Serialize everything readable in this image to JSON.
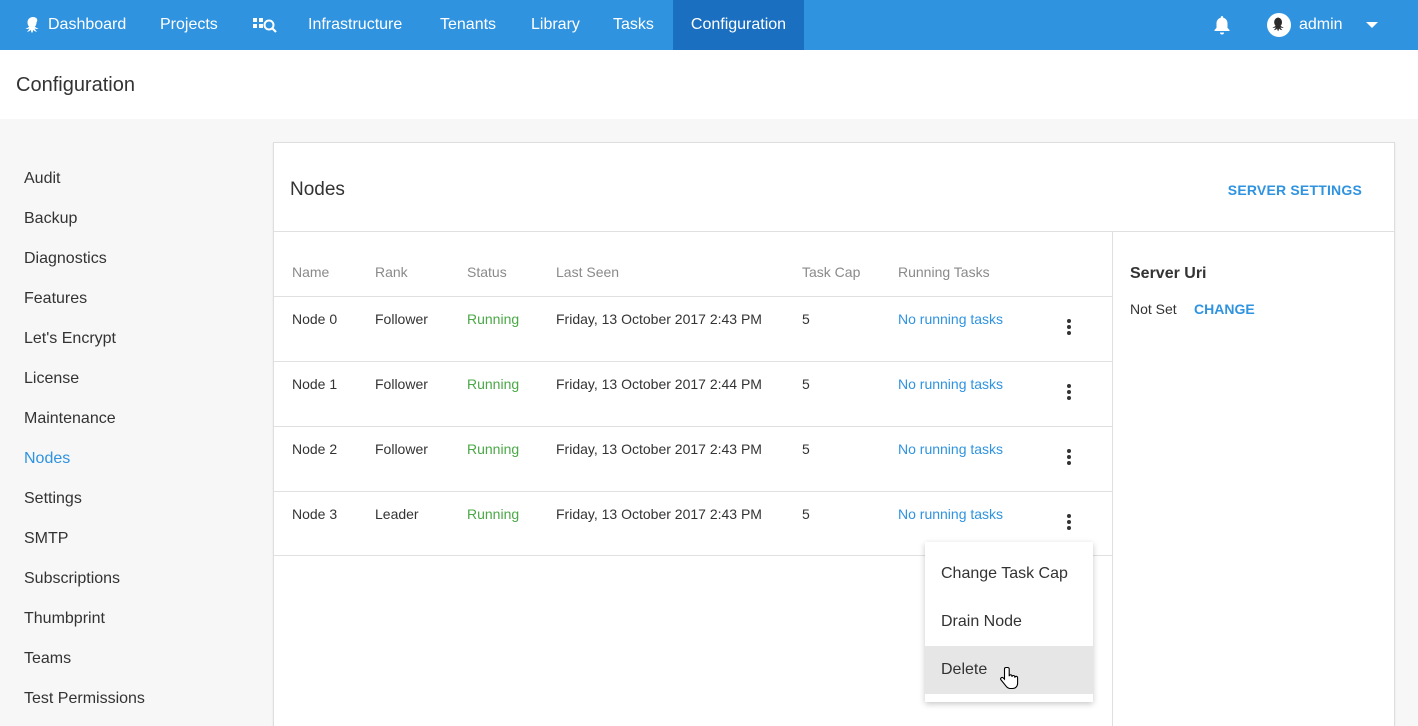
{
  "nav": {
    "dashboard": "Dashboard",
    "projects": "Projects",
    "infrastructure": "Infrastructure",
    "tenants": "Tenants",
    "library": "Library",
    "tasks": "Tasks",
    "configuration": "Configuration",
    "user": "admin",
    "icons": {
      "logo": "octopus-icon",
      "search": "search-icon",
      "bell": "bell-icon",
      "avatar": "avatar-icon"
    }
  },
  "colors": {
    "primary": "#2f93e0",
    "active_nav": "#1a6fc0",
    "running": "#4aa846"
  },
  "page": {
    "title": "Configuration"
  },
  "sidebar": {
    "items": [
      "Audit",
      "Backup",
      "Diagnostics",
      "Features",
      "Let's Encrypt",
      "License",
      "Maintenance",
      "Nodes",
      "Settings",
      "SMTP",
      "Subscriptions",
      "Thumbprint",
      "Teams",
      "Test Permissions"
    ],
    "active": "Nodes"
  },
  "card": {
    "title": "Nodes",
    "action": "SERVER SETTINGS"
  },
  "table": {
    "columns": [
      "Name",
      "Rank",
      "Status",
      "Last Seen",
      "Task Cap",
      "Running Tasks"
    ],
    "rows": [
      {
        "name": "Node 0",
        "rank": "Follower",
        "status": "Running",
        "last_seen": "Friday, 13 October 2017 2:43 PM",
        "task_cap": "5",
        "running_tasks": "No running tasks"
      },
      {
        "name": "Node 1",
        "rank": "Follower",
        "status": "Running",
        "last_seen": "Friday, 13 October 2017 2:44 PM",
        "task_cap": "5",
        "running_tasks": "No running tasks"
      },
      {
        "name": "Node 2",
        "rank": "Follower",
        "status": "Running",
        "last_seen": "Friday, 13 October 2017 2:43 PM",
        "task_cap": "5",
        "running_tasks": "No running tasks"
      },
      {
        "name": "Node 3",
        "rank": "Leader",
        "status": "Running",
        "last_seen": "Friday, 13 October 2017 2:43 PM",
        "task_cap": "5",
        "running_tasks": "No running tasks"
      }
    ]
  },
  "server_uri": {
    "title": "Server Uri",
    "value": "Not Set",
    "change": "CHANGE"
  },
  "menu": {
    "items": [
      "Change Task Cap",
      "Drain Node",
      "Delete"
    ],
    "hovered": "Delete"
  }
}
